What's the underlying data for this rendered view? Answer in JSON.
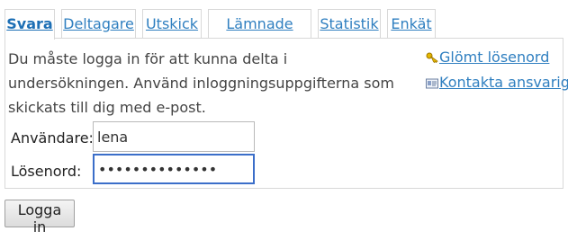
{
  "tabs": [
    {
      "label": "Svara",
      "active": true
    },
    {
      "label": "Deltagare"
    },
    {
      "label": "Utskick"
    },
    {
      "label": "Lämnade svar"
    },
    {
      "label": "Statistik"
    },
    {
      "label": "Enkät"
    }
  ],
  "login": {
    "message": "Du måste logga in för att kunna delta i undersökningen. Använd inloggningsuppgifterna som skickats till dig med e-post.",
    "user_label": "Användare:",
    "user_value": "lena",
    "password_label": "Lösenord:",
    "password_value": "lenapassword12",
    "submit_label": "Logga in"
  },
  "links": {
    "forgot_password": "Glömt lösenord",
    "contact": "Kontakta ansvarig"
  },
  "icons": {
    "forgot_password": "key-icon",
    "contact": "mail-card-icon"
  }
}
